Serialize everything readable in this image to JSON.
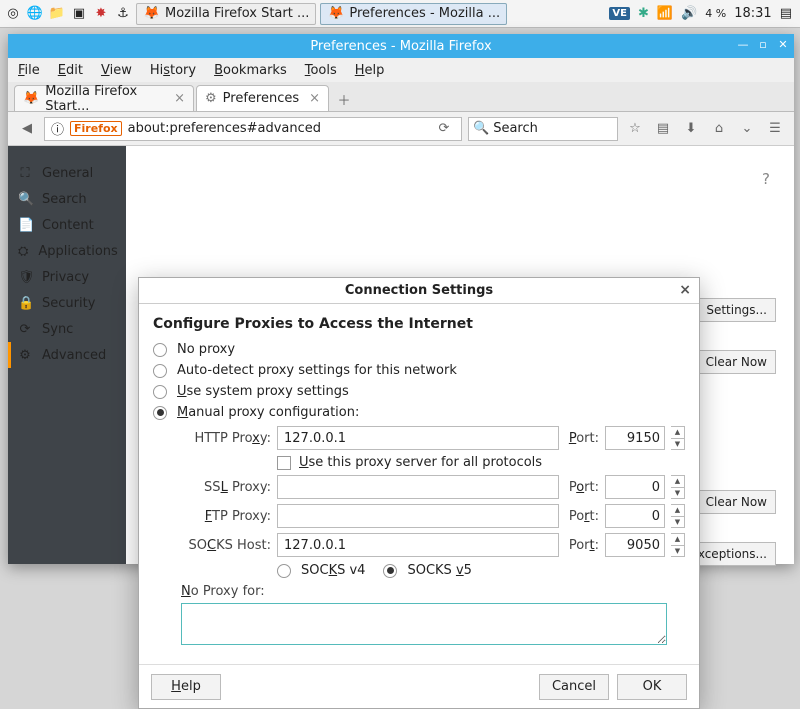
{
  "taskbar": {
    "buttons": [
      {
        "label": "Mozilla Firefox Start ..."
      },
      {
        "label": "Preferences - Mozilla ..."
      }
    ],
    "ve": "VE",
    "battery": "4 %",
    "clock": "18:31"
  },
  "window": {
    "title": "Preferences - Mozilla Firefox",
    "menu": {
      "file": "File",
      "edit": "Edit",
      "view": "View",
      "history": "History",
      "bookmarks": "Bookmarks",
      "tools": "Tools",
      "help": "Help"
    },
    "tabs": [
      {
        "label": "Mozilla Firefox Start..."
      },
      {
        "label": "Preferences"
      }
    ],
    "url_badge": "Firefox",
    "url": "about:preferences#advanced",
    "search_placeholder": "Search"
  },
  "sidebar": {
    "items": [
      {
        "icon": "⛶",
        "label": "General"
      },
      {
        "icon": "🔍",
        "label": "Search"
      },
      {
        "icon": "📄",
        "label": "Content"
      },
      {
        "icon": "⛭",
        "label": "Applications"
      },
      {
        "icon": "🛡",
        "label": "Privacy"
      },
      {
        "icon": "🔒",
        "label": "Security"
      },
      {
        "icon": "⟳",
        "label": "Sync"
      },
      {
        "icon": "⚙",
        "label": "Advanced"
      }
    ],
    "selected": 7
  },
  "bg_buttons": {
    "settings": "Settings...",
    "clearnow1": "Clear Now",
    "clearnow2": "Clear Now",
    "exceptions": "Exceptions..."
  },
  "dialog": {
    "title": "Connection Settings",
    "heading": "Configure Proxies to Access the Internet",
    "radios": {
      "none": "No proxy",
      "auto": "Auto-detect proxy settings for this network",
      "system": "Use system proxy settings",
      "manual": "Manual proxy configuration:"
    },
    "selected_radio": "manual",
    "http": {
      "label": "HTTP Proxy:",
      "host": "127.0.0.1",
      "portl": "Port:",
      "port": "9150"
    },
    "useall": "Use this proxy server for all protocols",
    "ssl": {
      "label": "SSL Proxy:",
      "host": "",
      "portl": "Port:",
      "port": "0"
    },
    "ftp": {
      "label": "FTP Proxy:",
      "host": "",
      "portl": "Port:",
      "port": "0"
    },
    "socks": {
      "label": "SOCKS Host:",
      "host": "127.0.0.1",
      "portl": "Port:",
      "port": "9050"
    },
    "socksver": {
      "v4": "SOCKS v4",
      "v5": "SOCKS v5",
      "selected": "v5"
    },
    "noproxy_label": "No Proxy for:",
    "buttons": {
      "help": "Help",
      "cancel": "Cancel",
      "ok": "OK"
    }
  }
}
